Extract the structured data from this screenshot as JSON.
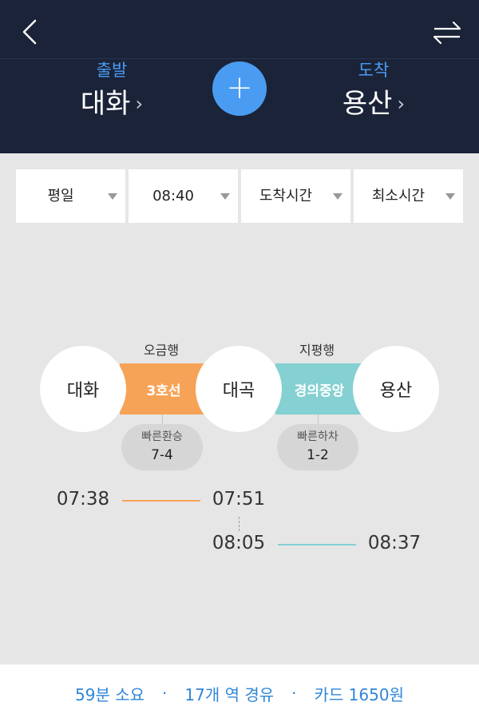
{
  "header": {
    "departure": {
      "label": "출발",
      "station": "대화"
    },
    "arrival": {
      "label": "도착",
      "station": "용산"
    }
  },
  "filters": [
    {
      "label": "평일"
    },
    {
      "label": "08:40"
    },
    {
      "label": "도착시간"
    },
    {
      "label": "최소시간"
    }
  ],
  "route": {
    "stations": [
      "대화",
      "대곡",
      "용산"
    ],
    "segments": [
      {
        "line": "3호선",
        "direction": "오금행",
        "color": "#f7a357",
        "depart_time": "07:38",
        "arrive_time": "07:51"
      },
      {
        "line": "경의중앙",
        "direction": "지평행",
        "color": "#85d0d2",
        "depart_time": "08:05",
        "arrive_time": "08:37"
      }
    ],
    "transfers": [
      {
        "title": "빠른환승",
        "value": "7-4"
      },
      {
        "title": "빠른하차",
        "value": "1-2"
      }
    ]
  },
  "summary": {
    "duration": "59분 소요",
    "stations": "17개 역 경유",
    "fare": "카드 1650원",
    "separator": "·"
  },
  "colors": {
    "header_bg": "#1b2339",
    "accent_blue": "#4a9cf2",
    "line3": "#f7a357",
    "gyeongui": "#85d0d2",
    "footer_text": "#2f86d8"
  }
}
